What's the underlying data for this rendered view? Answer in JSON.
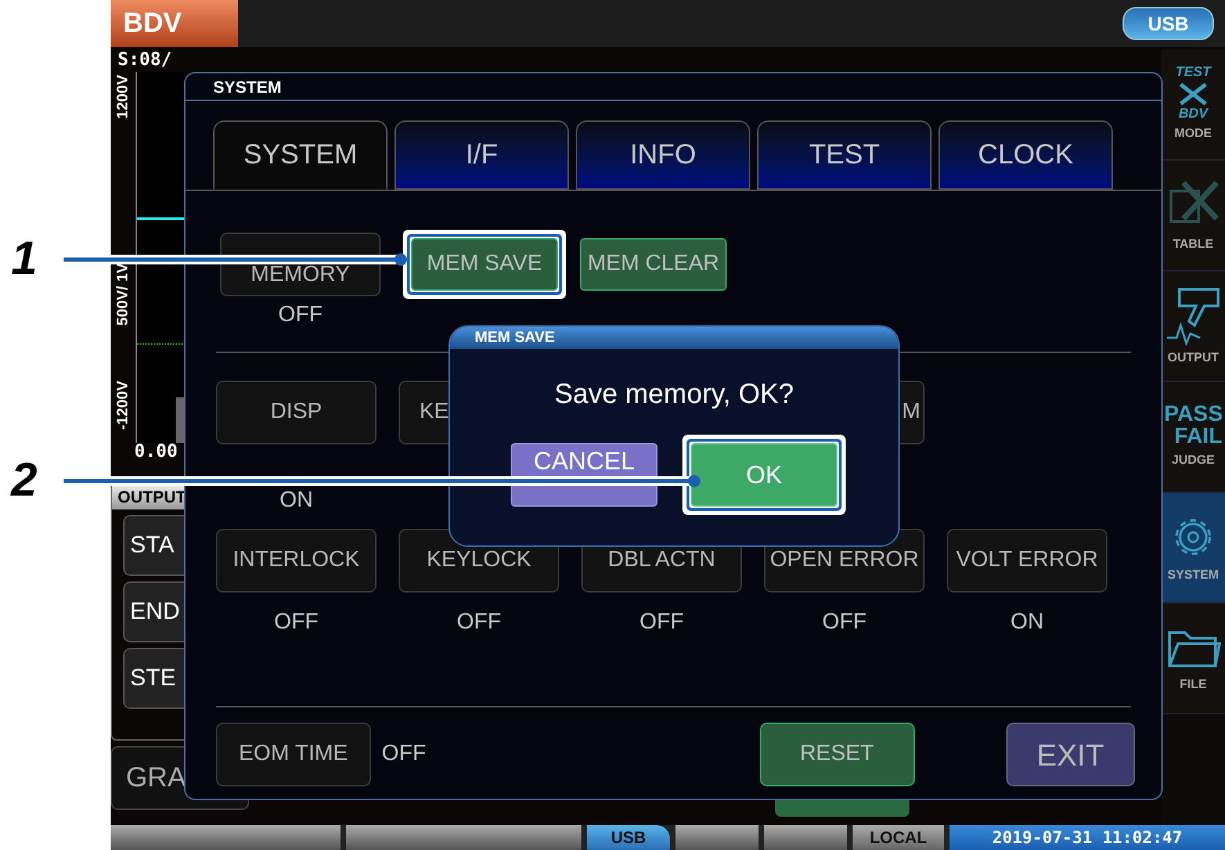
{
  "top_bar": {
    "mode_label": "BDV",
    "usb": "USB"
  },
  "measurement": "S:08/",
  "graph": {
    "axis_labels": [
      "1200V",
      "500V/ 1V",
      "-1200V"
    ],
    "reading": "0.00"
  },
  "output_panel": {
    "title": "OUTPUT",
    "buttons": [
      "STA",
      "END",
      "STE"
    ]
  },
  "graph_button": "GRA",
  "sidebar": [
    {
      "label": "MODE",
      "kind": "mode",
      "icon_text": [
        "TEST",
        "BDV"
      ],
      "selected": false
    },
    {
      "label": "TABLE",
      "kind": "table",
      "selected": false
    },
    {
      "label": "OUTPUT",
      "kind": "output",
      "selected": false
    },
    {
      "label": "JUDGE",
      "kind": "judge",
      "icon_text": [
        "PASS",
        "FAIL"
      ],
      "selected": false
    },
    {
      "label": "SYSTEM",
      "kind": "system",
      "selected": true
    },
    {
      "label": "FILE",
      "kind": "file",
      "selected": false
    }
  ],
  "status_bar": {
    "usb": "USB",
    "mode": "LOCAL",
    "datetime": "2019-07-31 11:02:47"
  },
  "system_dialog": {
    "title": "SYSTEM",
    "tabs": [
      {
        "label": "SYSTEM",
        "selected": true
      },
      {
        "label": "I/F",
        "selected": false
      },
      {
        "label": "INFO",
        "selected": false
      },
      {
        "label": "TEST",
        "selected": false
      },
      {
        "label": "CLOCK",
        "selected": false
      }
    ],
    "memory": {
      "label": "MEMORY",
      "value": "OFF"
    },
    "memory_actions": [
      {
        "label": "MEM SAVE",
        "highlighted": true
      },
      {
        "label": "MEM CLEAR",
        "highlighted": false
      }
    ],
    "display_row": [
      {
        "label": "DISP",
        "value": "ON"
      },
      {
        "label": "KE"
      },
      {
        "label": "M"
      }
    ],
    "settings": [
      {
        "label": "INTERLOCK",
        "value": "OFF"
      },
      {
        "label": "KEYLOCK",
        "value": "OFF"
      },
      {
        "label": "DBL ACTN",
        "value": "OFF"
      },
      {
        "label": "OPEN ERROR",
        "value": "OFF"
      },
      {
        "label": "VOLT ERROR",
        "value": "ON"
      }
    ],
    "eom": {
      "label": "EOM TIME",
      "value": "OFF"
    },
    "reset": "RESET",
    "exit": "EXIT"
  },
  "confirm_dialog": {
    "title": "MEM SAVE",
    "message": "Save memory, OK?",
    "buttons": [
      {
        "label": "CANCEL",
        "kind": "cancel",
        "highlighted": false
      },
      {
        "label": "OK",
        "kind": "ok",
        "highlighted": true
      }
    ]
  },
  "callouts": [
    {
      "number": "1"
    },
    {
      "number": "2"
    }
  ]
}
